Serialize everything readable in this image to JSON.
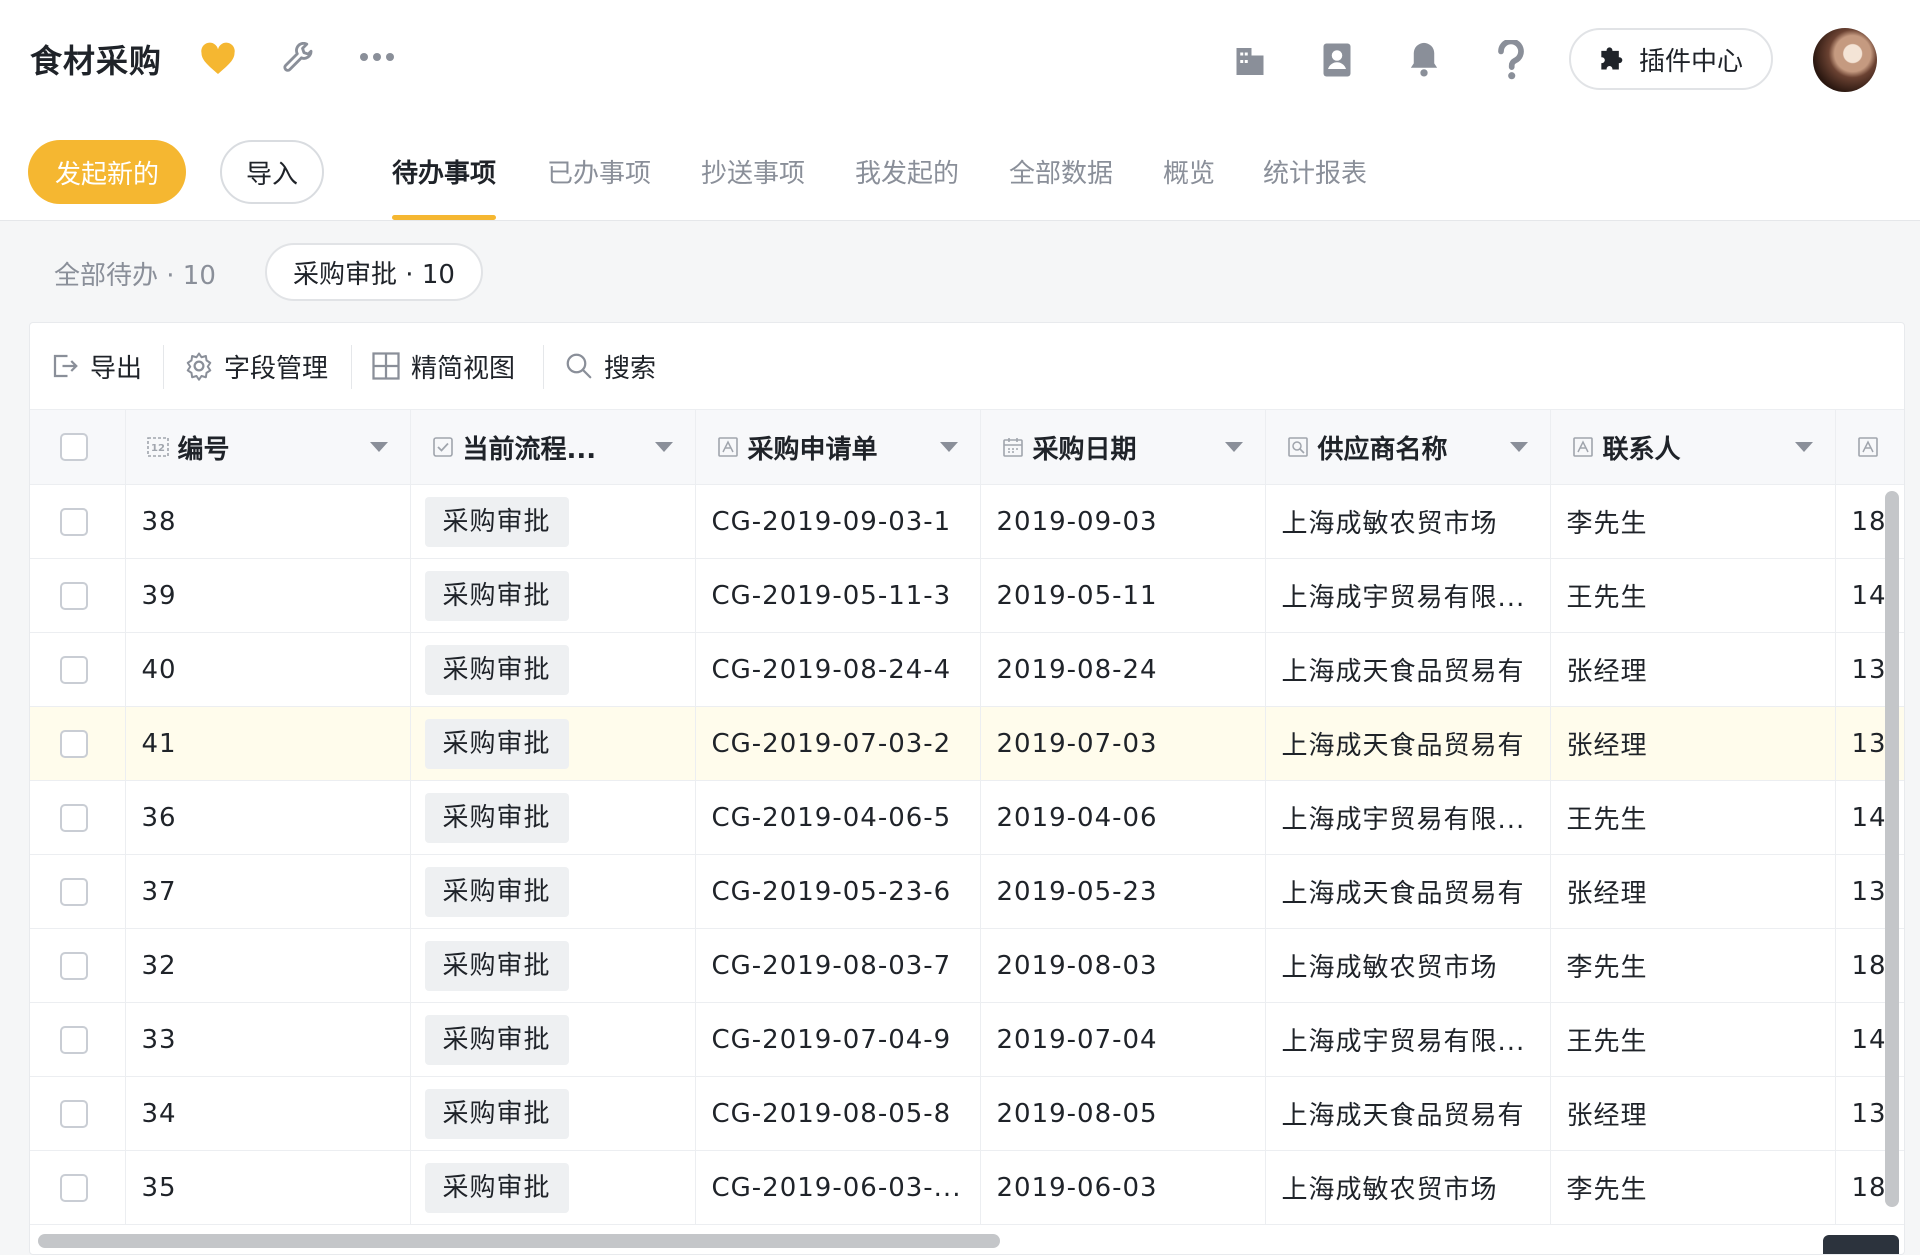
{
  "app": {
    "title": "食材采购"
  },
  "header": {
    "icons": [
      "heart-icon",
      "wrench-icon",
      "more-icon",
      "building-icon",
      "contacts-icon",
      "bell-icon",
      "help-icon"
    ],
    "plugin_label": "插件中心",
    "accent": "#f5b731"
  },
  "tabbar": {
    "new_label": "发起新的",
    "import_label": "导入",
    "tabs": [
      {
        "label": "待办事项",
        "active": true
      },
      {
        "label": "已办事项"
      },
      {
        "label": "抄送事项"
      },
      {
        "label": "我发起的"
      },
      {
        "label": "全部数据"
      },
      {
        "label": "概览"
      },
      {
        "label": "统计报表"
      }
    ]
  },
  "filters": {
    "all": "全部待办 · 10",
    "selected": "采购审批 · 10"
  },
  "toolbar": {
    "export": "导出",
    "fields": "字段管理",
    "compact": "精简视图",
    "search": "搜索"
  },
  "table": {
    "columns": [
      "编号",
      "当前流程...",
      "采购申请单",
      "采购日期",
      "供应商名称",
      "联系人"
    ],
    "rows": [
      {
        "id": "38",
        "stage": "采购审批",
        "order": "CG-2019-09-03-1",
        "date": "2019-09-03",
        "supplier": "上海成敏农贸市场",
        "contact": "李先生",
        "phone": "18"
      },
      {
        "id": "39",
        "stage": "采购审批",
        "order": "CG-2019-05-11-3",
        "date": "2019-05-11",
        "supplier": "上海成宇贸易有限...",
        "contact": "王先生",
        "phone": "14"
      },
      {
        "id": "40",
        "stage": "采购审批",
        "order": "CG-2019-08-24-4",
        "date": "2019-08-24",
        "supplier": "上海成天食品贸易有",
        "contact": "张经理",
        "phone": "13"
      },
      {
        "id": "41",
        "stage": "采购审批",
        "order": "CG-2019-07-03-2",
        "date": "2019-07-03",
        "supplier": "上海成天食品贸易有",
        "contact": "张经理",
        "phone": "13",
        "highlighted": true
      },
      {
        "id": "36",
        "stage": "采购审批",
        "order": "CG-2019-04-06-5",
        "date": "2019-04-06",
        "supplier": "上海成宇贸易有限...",
        "contact": "王先生",
        "phone": "14"
      },
      {
        "id": "37",
        "stage": "采购审批",
        "order": "CG-2019-05-23-6",
        "date": "2019-05-23",
        "supplier": "上海成天食品贸易有",
        "contact": "张经理",
        "phone": "13"
      },
      {
        "id": "32",
        "stage": "采购审批",
        "order": "CG-2019-08-03-7",
        "date": "2019-08-03",
        "supplier": "上海成敏农贸市场",
        "contact": "李先生",
        "phone": "18"
      },
      {
        "id": "33",
        "stage": "采购审批",
        "order": "CG-2019-07-04-9",
        "date": "2019-07-04",
        "supplier": "上海成宇贸易有限...",
        "contact": "王先生",
        "phone": "14"
      },
      {
        "id": "34",
        "stage": "采购审批",
        "order": "CG-2019-08-05-8",
        "date": "2019-08-05",
        "supplier": "上海成天食品贸易有",
        "contact": "张经理",
        "phone": "13"
      },
      {
        "id": "35",
        "stage": "采购审批",
        "order": "CG-2019-06-03-...",
        "date": "2019-06-03",
        "supplier": "上海成敏农贸市场",
        "contact": "李先生",
        "phone": "18"
      }
    ]
  }
}
